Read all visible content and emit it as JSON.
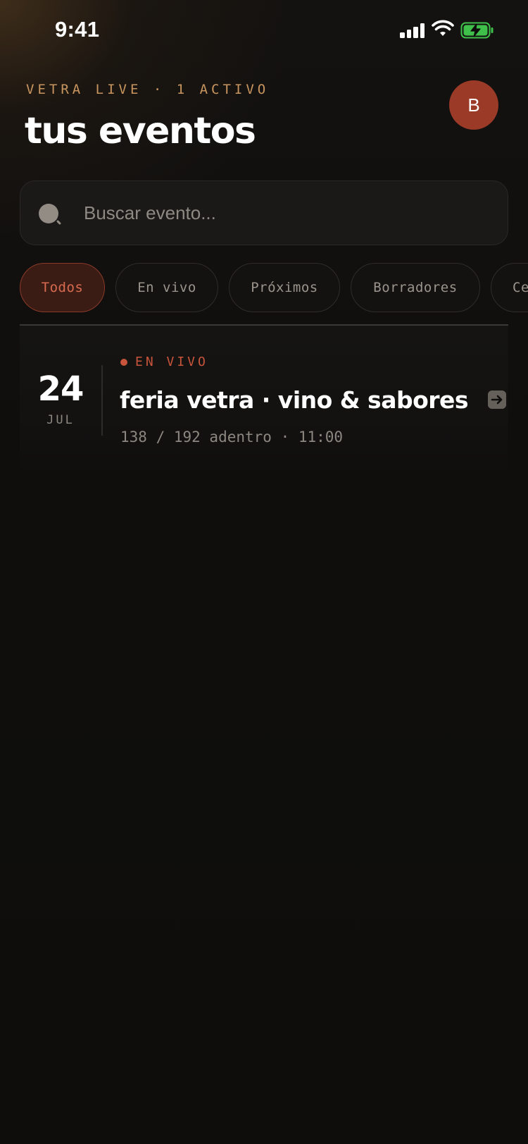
{
  "status_bar": {
    "time": "9:41"
  },
  "header": {
    "eyebrow": "VETRA LIVE · 1 ACTIVO",
    "title": "tus eventos",
    "avatar_initial": "B"
  },
  "search": {
    "placeholder": "Buscar evento..."
  },
  "filters": [
    "Todos",
    "En vivo",
    "Próximos",
    "Borradores",
    "Ce"
  ],
  "active_filter": "Todos",
  "events": [
    {
      "day": "24",
      "month": "JUL",
      "status": "EN VIVO",
      "title": "feria vetra · vino & sabores",
      "meta": "138 / 192 adentro · 11:00"
    }
  ],
  "colors": {
    "accent": "#c8553b",
    "eyebrow": "#c9955f",
    "avatar_bg": "#9c3a28",
    "background": "#0e0d0c"
  },
  "icons": [
    "signal-icon",
    "wifi-icon",
    "battery-charging-icon",
    "search-icon",
    "arrow-right-icon"
  ]
}
